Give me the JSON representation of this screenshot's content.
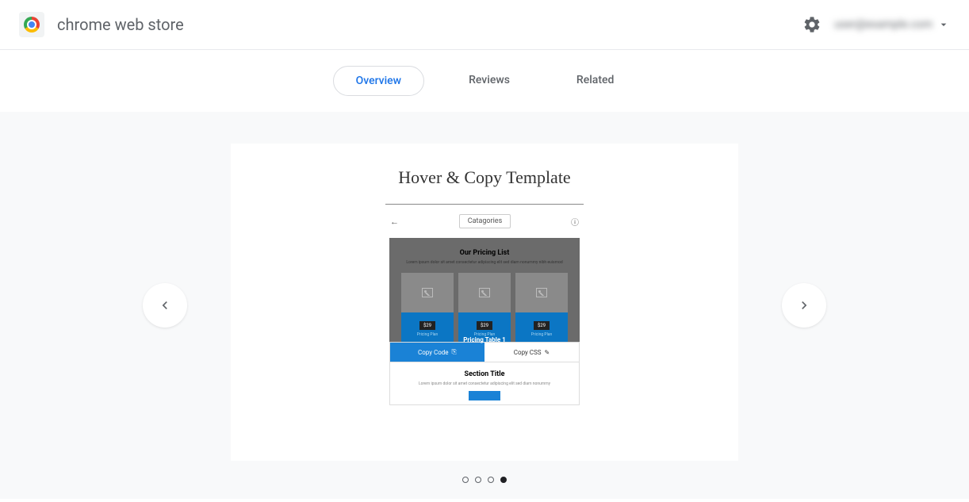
{
  "header": {
    "title": "chrome web store",
    "email": "user@example.com"
  },
  "tabs": [
    {
      "label": "Overview",
      "active": true
    },
    {
      "label": "Reviews",
      "active": false
    },
    {
      "label": "Related",
      "active": false
    }
  ],
  "screenshot": {
    "title": "Hover & Copy Template",
    "categories_label": "Catagories",
    "pricing": {
      "heading": "Our Pricing List",
      "subtitle": "Lorem ipsum dolor sit amet consectetur adipiscing elit sed diam nonummy nibh euismod",
      "price": "$29",
      "card_label": "Pricing Plan",
      "hover_label": "Pricing Table 1"
    },
    "actions": {
      "copy_code": "Copy Code",
      "copy_css": "Copy CSS"
    },
    "section": {
      "title": "Section Title",
      "subtitle": "Lorem ipsum dolor sit amet consectetur adipiscing elit sed diam nonummy"
    }
  },
  "carousel": {
    "total_dots": 4,
    "active_dot": 3
  }
}
